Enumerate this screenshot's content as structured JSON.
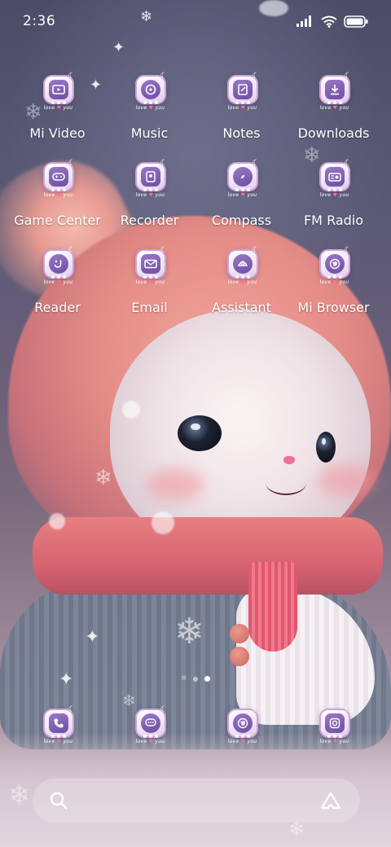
{
  "status_bar": {
    "time": "2:36"
  },
  "home": {
    "apps": [
      {
        "label": "Mi Video",
        "icon": "mi-video-icon"
      },
      {
        "label": "Music",
        "icon": "music-icon"
      },
      {
        "label": "Notes",
        "icon": "notes-icon"
      },
      {
        "label": "Downloads",
        "icon": "downloads-icon"
      },
      {
        "label": "Game Center",
        "icon": "game-center-icon"
      },
      {
        "label": "Recorder",
        "icon": "recorder-icon"
      },
      {
        "label": "Compass",
        "icon": "compass-icon"
      },
      {
        "label": "FM Radio",
        "icon": "fm-radio-icon"
      },
      {
        "label": "Reader",
        "icon": "reader-icon"
      },
      {
        "label": "Email",
        "icon": "email-icon"
      },
      {
        "label": "Assistant",
        "icon": "assistant-icon"
      },
      {
        "label": "Mi Browser",
        "icon": "mi-browser-icon"
      }
    ],
    "dock": [
      {
        "icon": "phone-icon"
      },
      {
        "icon": "messaging-icon"
      },
      {
        "icon": "browser-icon"
      },
      {
        "icon": "camera-icon"
      }
    ],
    "icon_caption": "love",
    "icon_caption_suffix": "you",
    "page_count": 2,
    "active_page": 2
  },
  "colors": {
    "icon_frame": "#cba3d8",
    "icon_glyph": "#7b59b0",
    "accent_heart": "#ff6e9a"
  }
}
